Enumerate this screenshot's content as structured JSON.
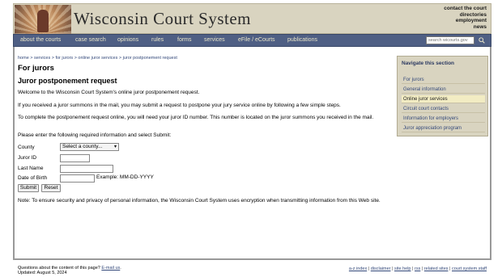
{
  "header": {
    "site_title": "Wisconsin Court System",
    "utility_links": [
      "contact the court",
      "directories",
      "employment",
      "news"
    ]
  },
  "nav": {
    "items": [
      "about the courts",
      "case search",
      "opinions",
      "rules",
      "forms",
      "services",
      "eFile / eCourts",
      "publications"
    ],
    "search_placeholder": "search wicourts.gov"
  },
  "breadcrumb": "home > services > for jurors > online juror services > juror postponement request",
  "main": {
    "title": "For jurors",
    "subheading": "Juror postponement request",
    "paragraphs": [
      "Welcome to the Wisconsin Court System's online juror postponement request.",
      "If you received a juror summons in the mail, you may submit a request to postpone your jury service online by following a few simple steps.",
      "To complete the postponement request online, you will need your juror ID number. This number is located on the juror summons you received in the mail.",
      "Please enter the following required information and select Submit:"
    ],
    "note": "Note: To ensure security and privacy of personal information, the Wisconsin Court System uses encryption when transmitting information from this Web site."
  },
  "form": {
    "county_label": "County",
    "county_selected": "Select a county...",
    "juror_id_label": "Juror ID",
    "juror_id_value": "",
    "last_name_label": "Last Name",
    "last_name_value": "",
    "dob_label": "Date of Birth",
    "dob_value": "",
    "dob_hint": "Example: MM-DD-YYYY",
    "submit_label": "Submit",
    "reset_label": "Reset"
  },
  "sidebar": {
    "title": "Navigate this section",
    "items": [
      "For jurors",
      "General information",
      "Online juror services",
      "Circuit court contacts",
      "Information for employers",
      "Juror appreciation program"
    ],
    "active_index": 2
  },
  "footer": {
    "question_text": "Questions about the content of this page?",
    "email_label": "E-mail us",
    "updated": "Updated: August 5, 2024",
    "links": [
      "a-z index",
      "disclaimer",
      "site help",
      "rss",
      "related sites",
      "court system staff"
    ]
  },
  "colors": {
    "nav_bg": "#4f5f84",
    "header_bg": "#d9d4c0",
    "link": "#34497a",
    "active_side": "#f2ecc3"
  }
}
